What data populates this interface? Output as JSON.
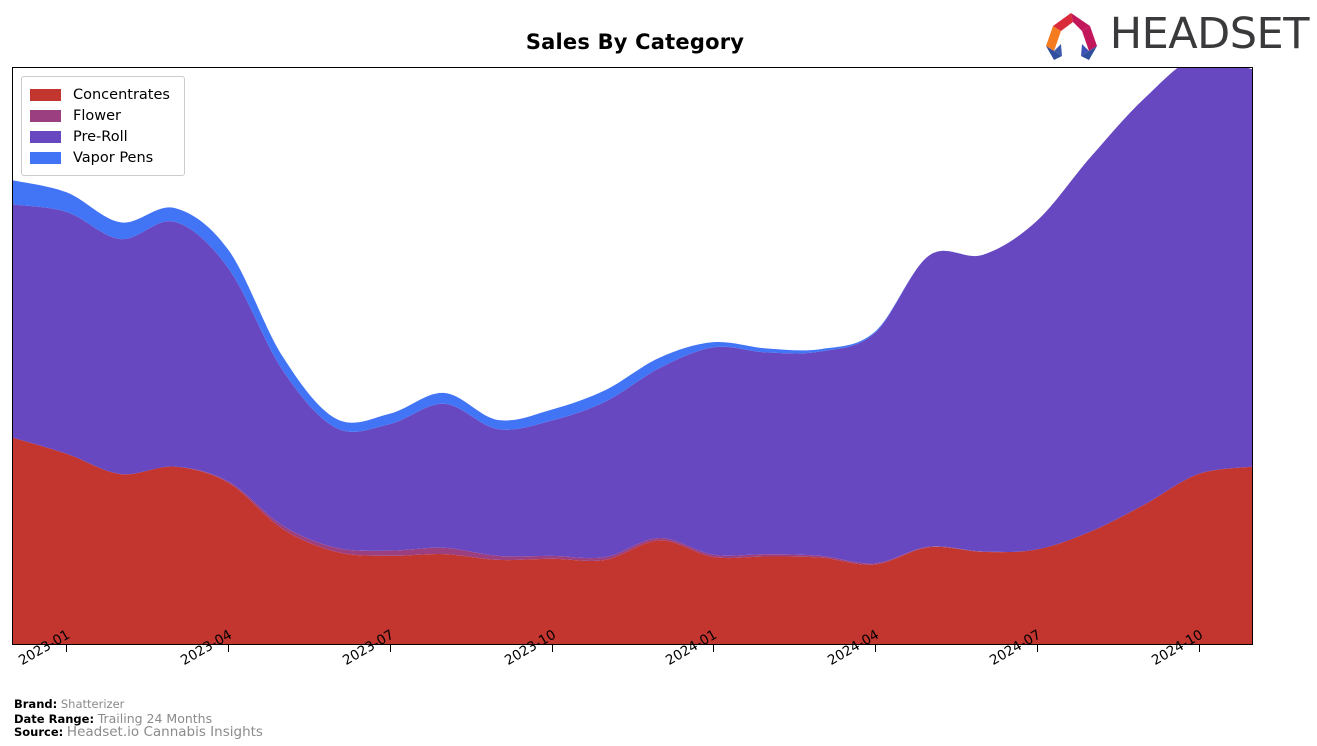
{
  "header": {
    "title": "Sales By Category",
    "logo_word": "HEADSET",
    "logo_colors": {
      "orange": "#F47B20",
      "red": "#D92B3A",
      "crimson": "#C2185B",
      "magenta": "#C2185B",
      "blue": "#3B5BA9",
      "indigo": "#3F51B5"
    }
  },
  "legend": {
    "position": "upper-left",
    "items": [
      {
        "label": "Concentrates",
        "color": "#C3352F"
      },
      {
        "label": "Flower",
        "color": "#9C3F80"
      },
      {
        "label": "Pre-Roll",
        "color": "#6748C0"
      },
      {
        "label": "Vapor Pens",
        "color": "#4275F6"
      }
    ]
  },
  "footnote": {
    "brand_key": "Brand:",
    "brand_value": "Shatterizer",
    "date_range_key": "Date Range:",
    "date_range_value": "Trailing 24 Months",
    "source_key": "Source:",
    "source_value": "Headset.io Cannabis Insights"
  },
  "chart_data": {
    "type": "area",
    "stacked": true,
    "title": "Sales By Category",
    "xlabel": "",
    "ylabel": "",
    "grid": false,
    "legend_position": "upper-left",
    "x_tick_labels": [
      "2023-01",
      "2023-04",
      "2023-07",
      "2023-10",
      "2024-01",
      "2024-04",
      "2024-07",
      "2024-10"
    ],
    "x_tick_label_rotation": -30,
    "x": [
      "2022-12",
      "2023-01",
      "2023-02",
      "2023-03",
      "2023-04",
      "2023-05",
      "2023-06",
      "2023-07",
      "2023-08",
      "2023-09",
      "2023-10",
      "2023-11",
      "2023-12",
      "2024-01",
      "2024-02",
      "2024-03",
      "2024-04",
      "2024-05",
      "2024-06",
      "2024-07",
      "2024-08",
      "2024-09",
      "2024-10",
      "2024-11"
    ],
    "ylim": [
      0,
      100
    ],
    "y_axis_visible": false,
    "series": [
      {
        "name": "Concentrates",
        "color": "#C3352F",
        "values": [
          35.8,
          33.0,
          29.5,
          30.8,
          28.0,
          20.0,
          16.0,
          15.3,
          15.6,
          14.6,
          14.8,
          14.6,
          18.0,
          15.1,
          15.2,
          15.0,
          13.8,
          16.8,
          16.0,
          16.4,
          19.5,
          24.2,
          29.5,
          30.8
        ]
      },
      {
        "name": "Flower",
        "color": "#9C3F80",
        "values": [
          0.0,
          0.0,
          0.0,
          0.0,
          0.2,
          0.6,
          0.7,
          0.9,
          1.1,
          0.7,
          0.5,
          0.5,
          0.4,
          0.4,
          0.4,
          0.3,
          0.2,
          0.1,
          0.05,
          0.0,
          0.0,
          0.0,
          0.0,
          0.0
        ]
      },
      {
        "name": "Pre-Roll",
        "color": "#6748C0",
        "values": [
          40.5,
          42.0,
          40.8,
          42.5,
          37.0,
          27.0,
          20.8,
          22.0,
          25.0,
          22.0,
          23.5,
          27.0,
          29.5,
          36.0,
          35.0,
          35.5,
          40.0,
          50.5,
          51.5,
          57.0,
          65.0,
          70.5,
          72.5,
          69.0
        ]
      },
      {
        "name": "Vapor Pens",
        "color": "#4275F6",
        "values": [
          4.2,
          3.4,
          2.9,
          2.4,
          3.2,
          2.4,
          1.6,
          1.8,
          1.9,
          1.6,
          1.9,
          2.0,
          1.8,
          0.9,
          0.7,
          0.4,
          0.2,
          0.0,
          0.0,
          0.0,
          0.0,
          0.0,
          0.0,
          0.0
        ]
      }
    ]
  }
}
